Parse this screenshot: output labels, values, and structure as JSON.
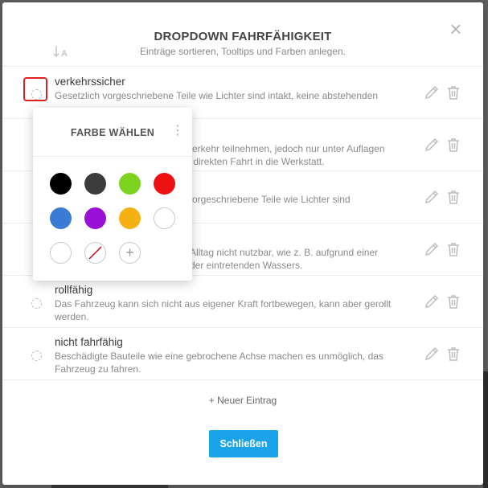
{
  "dialog": {
    "title": "DROPDOWN FAHRFÄHIGKEIT",
    "subtitle": "Einträge sortieren, Tooltips und Farben anlegen.",
    "close_icon": "close-icon",
    "sort_icon": "sort-alpha-icon"
  },
  "entries": [
    {
      "label": "verkehrssicher",
      "desc": "Gesetzlich vorgeschriebene Teile wie Lichter sind intakt, keine abstehenden Teile."
    },
    {
      "label": "",
      "desc": "verkehr teilnehmen, jedoch nur unter Auflagen\nr direkten Fahrt in die Werkstatt."
    },
    {
      "label": "",
      "desc": "vorgeschriebene Teile wie Lichter sind"
    },
    {
      "label": "",
      "desc": "Alltag nicht nutzbar, wie z. B. aufgrund einer\nder eintretenden Wassers."
    },
    {
      "label": "rollfähig",
      "desc": "Das Fahrzeug kann sich nicht aus eigener Kraft fortbewegen, kann aber gerollt werden."
    },
    {
      "label": "nicht fahrfähig",
      "desc": "Beschädigte Bauteile wie eine gebrochene Achse machen es unmöglich, das Fahrzeug zu fahren."
    }
  ],
  "actions": {
    "new_entry": "+ Neuer Eintrag",
    "close": "Schließen"
  },
  "color_picker": {
    "title": "FARBE WÄHLEN",
    "swatches": [
      "#000000",
      "#3c3c3c",
      "#7ed321",
      "#ee1111",
      "#3a7bd5",
      "#9b10d8",
      "#f5b014",
      "#ffffff",
      "#ffffff"
    ],
    "no_color_icon": "no-color-icon",
    "add_icon": "plus-icon"
  },
  "colors": {
    "accent": "#1aa3e8",
    "highlight": "#e02020"
  }
}
